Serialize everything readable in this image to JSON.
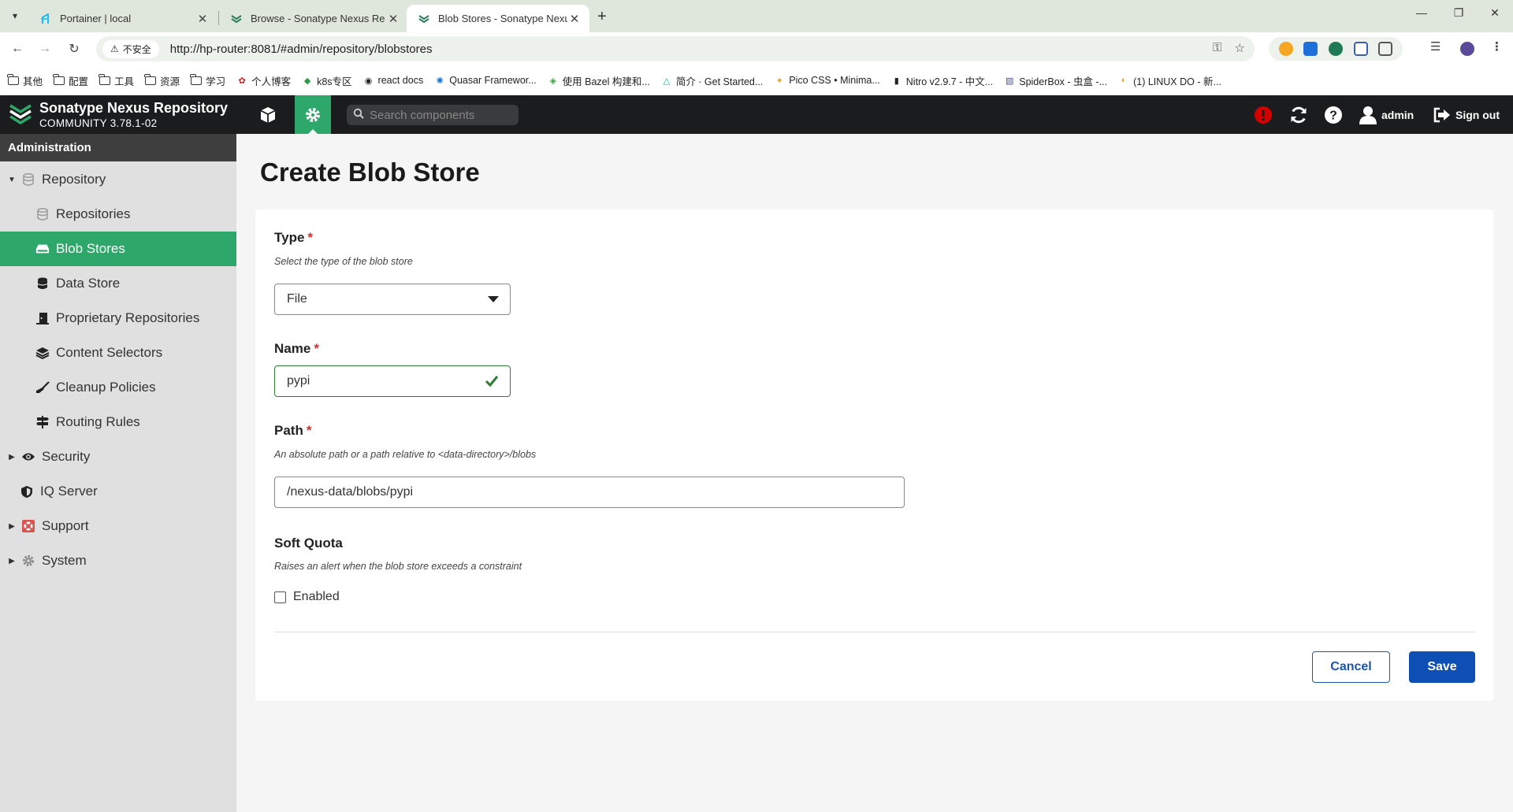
{
  "browser": {
    "tabs": [
      {
        "title": "Portainer | local",
        "favicon": "portainer-icon"
      },
      {
        "title": "Browse - Sonatype Nexus Re",
        "favicon": "nexus-icon"
      },
      {
        "title": "Blob Stores - Sonatype Nexu",
        "favicon": "nexus-icon"
      }
    ],
    "insecure_label": "不安全",
    "url": "http://hp-router:8081/#admin/repository/blobstores",
    "bookmarks": [
      {
        "label": "其他",
        "icon": "folder-icon"
      },
      {
        "label": "配置",
        "icon": "folder-icon"
      },
      {
        "label": "工具",
        "icon": "folder-icon"
      },
      {
        "label": "资源",
        "icon": "folder-icon"
      },
      {
        "label": "学习",
        "icon": "folder-icon"
      },
      {
        "label": "个人博客",
        "icon": "blog-icon"
      },
      {
        "label": "k8s专区",
        "icon": "k8s-icon"
      },
      {
        "label": "react docs",
        "icon": "react-icon"
      },
      {
        "label": "Quasar Framewor...",
        "icon": "quasar-icon"
      },
      {
        "label": "使用 Bazel 构建和...",
        "icon": "bazel-icon"
      },
      {
        "label": "简介 · Get Started...",
        "icon": "nuxt-icon"
      },
      {
        "label": "Pico CSS • Minima...",
        "icon": "pico-icon"
      },
      {
        "label": "Nitro v2.9.7 - 中文...",
        "icon": "nitro-icon"
      },
      {
        "label": "SpiderBox - 虫盒 -...",
        "icon": "spiderbox-icon"
      },
      {
        "label": "(1) LINUX DO - 新...",
        "icon": "linuxdo-icon"
      }
    ]
  },
  "header": {
    "app_title": "Sonatype Nexus Repository",
    "edition": "COMMUNITY 3.78.1-02",
    "search_placeholder": "Search components",
    "user_label": "admin",
    "signout_label": "Sign out"
  },
  "sidebar": {
    "heading": "Administration",
    "items": [
      {
        "label": "Repository",
        "icon": "database-icon"
      },
      {
        "label": "Repositories",
        "icon": "database-icon"
      },
      {
        "label": "Blob Stores",
        "icon": "hdd-icon"
      },
      {
        "label": "Data Store",
        "icon": "database-icon"
      },
      {
        "label": "Proprietary Repositories",
        "icon": "door-icon"
      },
      {
        "label": "Content Selectors",
        "icon": "layers-icon"
      },
      {
        "label": "Cleanup Policies",
        "icon": "broom-icon"
      },
      {
        "label": "Routing Rules",
        "icon": "signpost-icon"
      },
      {
        "label": "Security",
        "icon": "eye-icon"
      },
      {
        "label": "IQ Server",
        "icon": "shield-icon"
      },
      {
        "label": "Support",
        "icon": "lifebuoy-icon"
      },
      {
        "label": "System",
        "icon": "gear-icon"
      }
    ]
  },
  "main": {
    "title": "Create Blob Store",
    "type": {
      "label": "Type",
      "help": "Select the type of the blob store",
      "value": "File"
    },
    "name": {
      "label": "Name",
      "value": "pypi"
    },
    "path": {
      "label": "Path",
      "help": "An absolute path or a path relative to <data-directory>/blobs",
      "value": "/nexus-data/blobs/pypi"
    },
    "soft_quota": {
      "label": "Soft Quota",
      "help": "Raises an alert when the blob store exceeds a constraint",
      "checkbox_label": "Enabled",
      "checked": false
    },
    "required_marker": "*",
    "cancel_label": "Cancel",
    "save_label": "Save"
  },
  "colors": {
    "accent_green": "#2ea86a",
    "header_dark": "#1b1c1d",
    "primary_blue": "#0e4fb6",
    "required_red": "#d32f2f"
  }
}
